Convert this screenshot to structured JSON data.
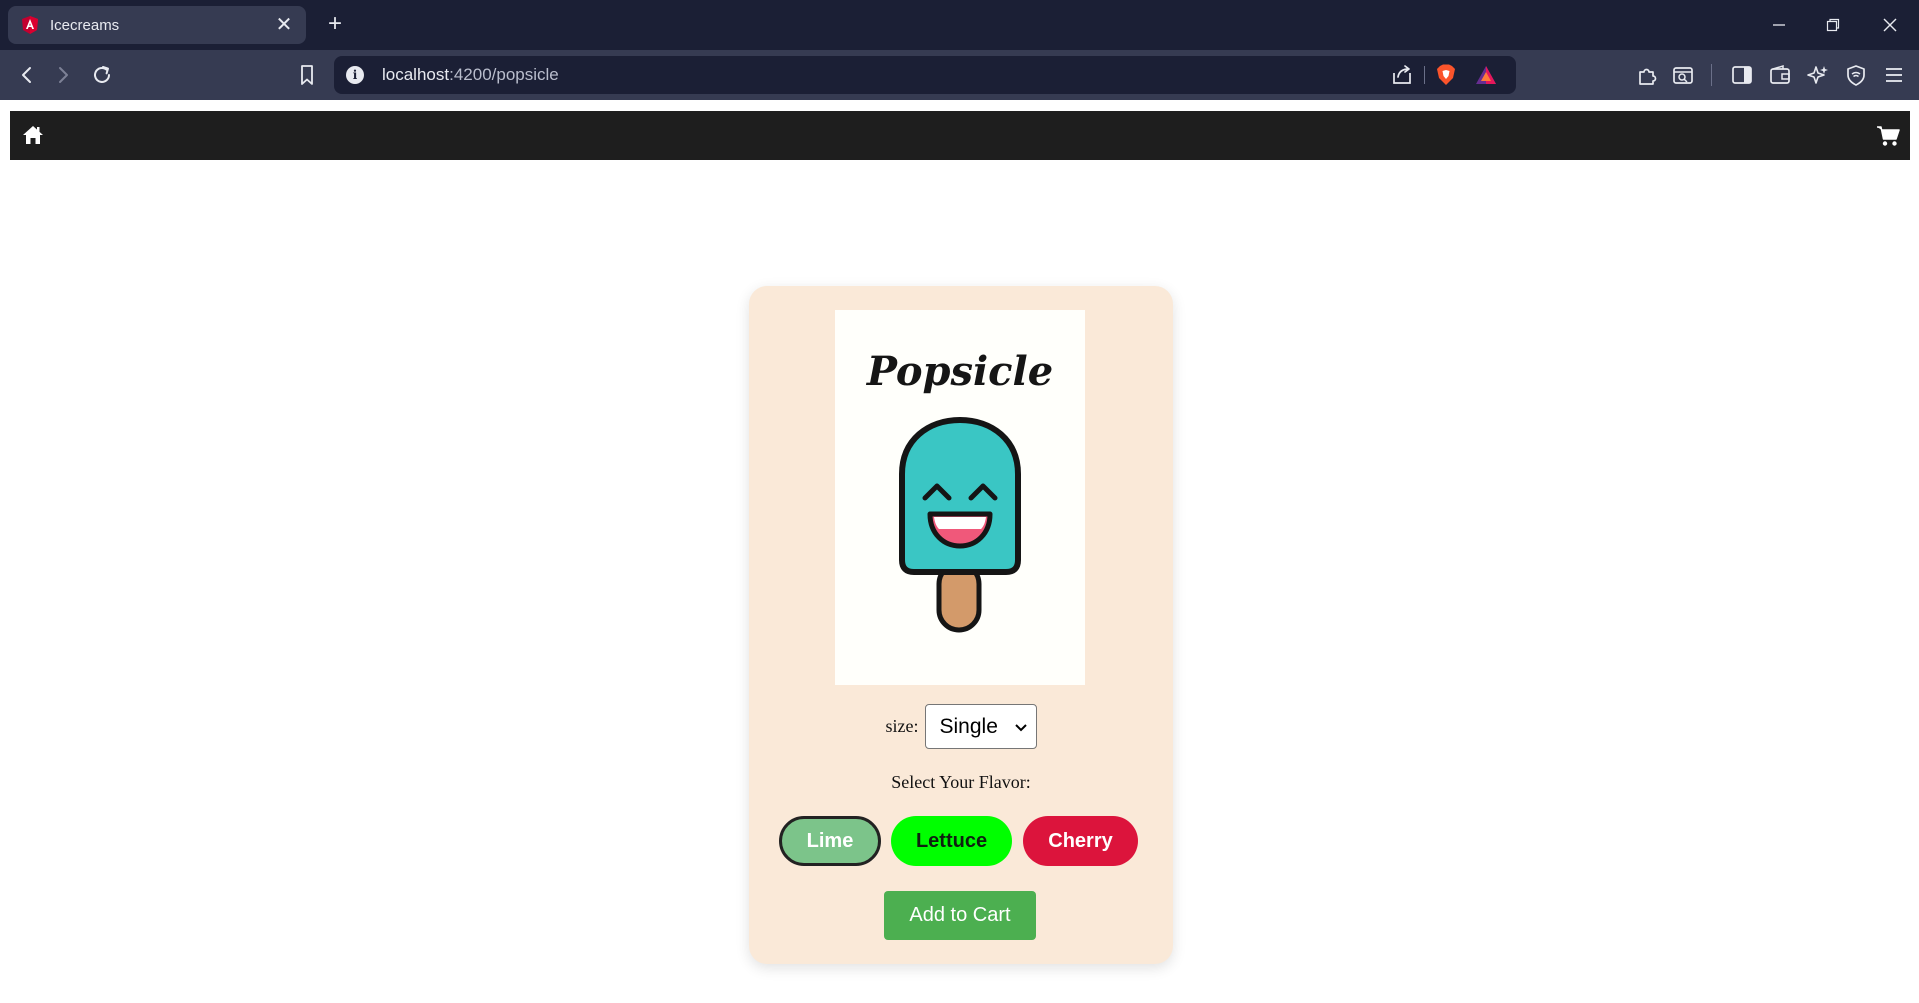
{
  "browser": {
    "tab_title": "Icecreams",
    "tab_close_glyph": "✕",
    "new_tab_glyph": "+",
    "url_host": "localhost",
    "url_path": ":4200/popsicle",
    "info_glyph": "i"
  },
  "icons": {
    "favicon": "angular-icon",
    "back": "back-arrow-icon",
    "forward": "forward-arrow-icon",
    "reload": "reload-icon",
    "bookmark": "bookmark-icon",
    "share": "share-icon",
    "brave_shields": "brave-shields-icon",
    "brave_rewards": "brave-rewards-icon",
    "extensions": "extensions-icon",
    "screenshot": "capture-icon",
    "sidebar": "sidebar-icon",
    "wallet": "wallet-icon",
    "leo": "leo-ai-icon",
    "vpn": "vpn-icon",
    "menu": "menu-icon",
    "home": "home-icon",
    "cart": "cart-icon"
  },
  "product": {
    "image_title": "Popsicle",
    "size_label": "size:",
    "size_selected": "Single",
    "flavor_heading": "Select Your Flavor:",
    "flavors": [
      {
        "label": "Lime",
        "color": "#7cc48a",
        "selected": true
      },
      {
        "label": "Lettuce",
        "color": "#00ff00",
        "selected": false
      },
      {
        "label": "Cherry",
        "color": "#dc143c",
        "selected": false
      }
    ],
    "add_to_cart": "Add to Cart"
  },
  "colors": {
    "chrome_dark": "#1b1f35",
    "chrome_toolbar": "#363b52",
    "navbar": "#1e1e1e",
    "card": "#fae9d8",
    "popsicle_body": "#3ac6c4",
    "add_to_cart": "#4caf50"
  }
}
